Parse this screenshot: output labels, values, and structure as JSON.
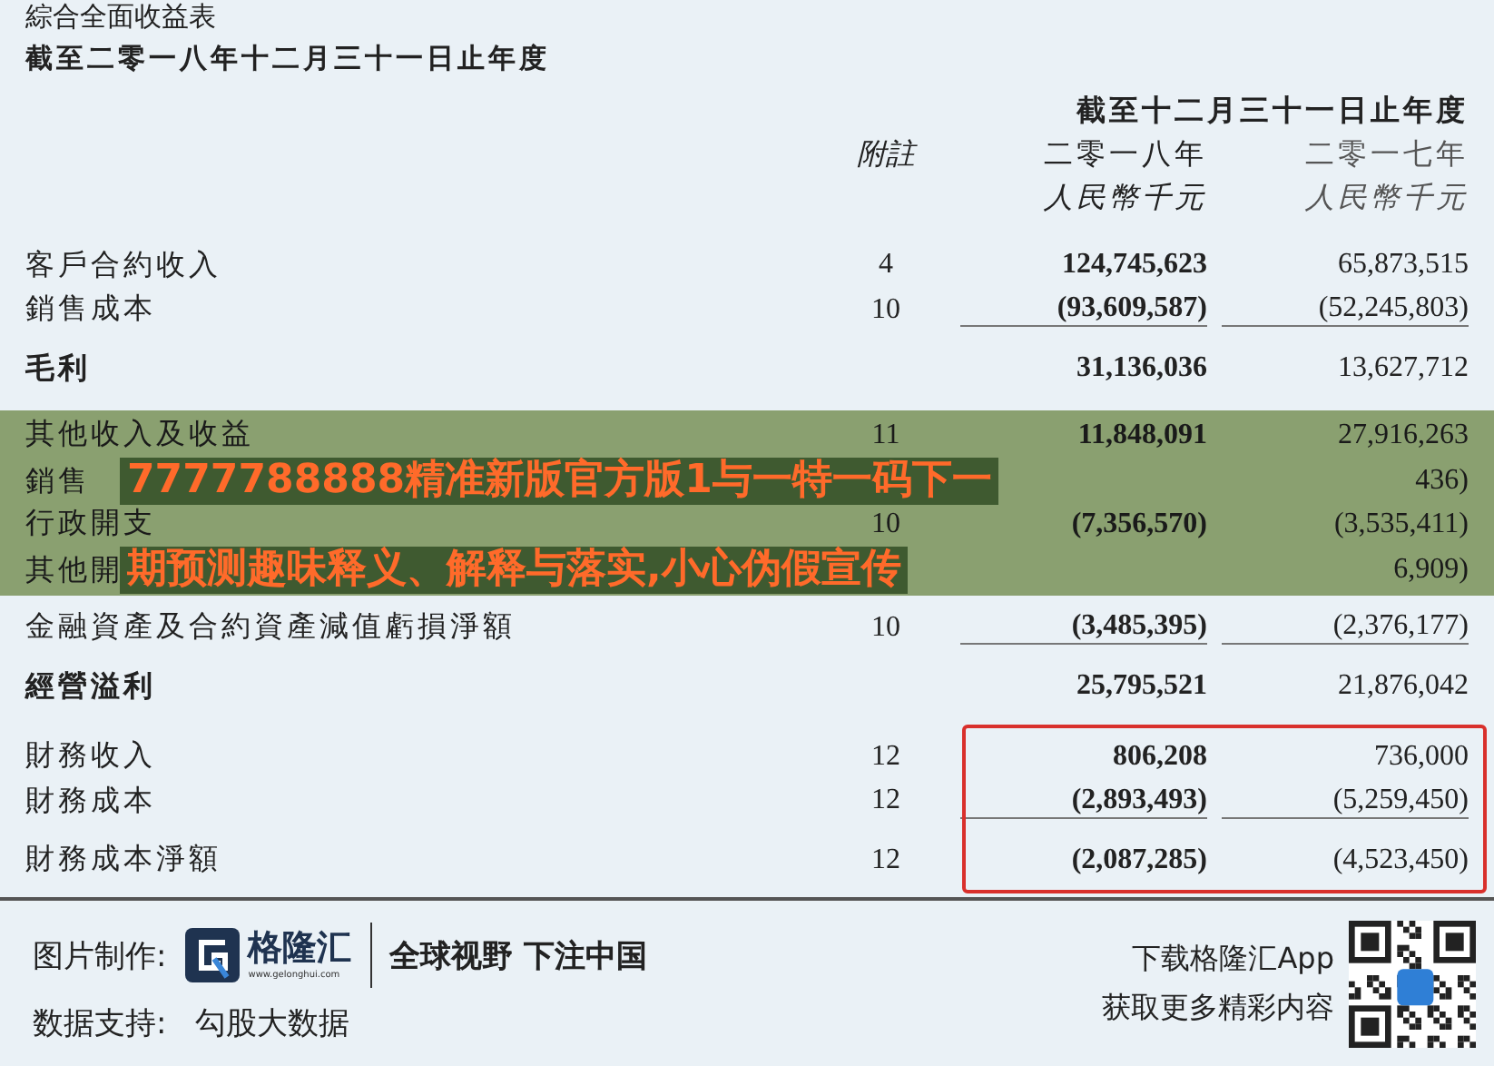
{
  "statement": {
    "title": "綜合全面收益表",
    "subtitle": "截至二零一八年十二月三十一日止年度",
    "period_header": "截至十二月三十一日止年度",
    "note_header": "附註",
    "years": [
      {
        "year": "二零一八年",
        "unit": "人民幣千元",
        "emphasis": true
      },
      {
        "year": "二零一七年",
        "unit": "人民幣千元",
        "emphasis": false
      }
    ],
    "rows": [
      {
        "kind": "item",
        "label": "客戶合約收入",
        "note": "4",
        "values": [
          "124,745,623",
          "65,873,515"
        ],
        "rule_below": false
      },
      {
        "kind": "item",
        "label": "銷售成本",
        "note": "10",
        "values": [
          "(93,609,587)",
          "(52,245,803)"
        ],
        "rule_below": true
      },
      {
        "kind": "total",
        "label": "毛利",
        "values": [
          "31,136,036",
          "13,627,712"
        ],
        "rule_below": false
      }
    ],
    "banner_band": [
      {
        "kind": "item",
        "label": "其他收入及收益",
        "note": "11",
        "values": [
          "11,848,091",
          "27,916,263"
        ],
        "rule_below": false
      },
      {
        "kind": "overlaid",
        "label": "銷售",
        "banner_text": "7777788888精准新版官方版1与一特一码下一",
        "value_2017": "436)"
      },
      {
        "kind": "item",
        "label": "行政開支",
        "note": "10",
        "values": [
          "(7,356,570)",
          "(3,535,411)"
        ],
        "rule_below": false
      },
      {
        "kind": "overlaid",
        "label": "其他開",
        "banner_text": "期预测趣味释义、解释与落实,小心伪假宣传",
        "value_2017": "6,909)"
      }
    ],
    "rows_after_banner": [
      {
        "kind": "item",
        "label": "金融資產及合約資產減值虧損淨額",
        "note": "10",
        "values": [
          "(3,485,395)",
          "(2,376,177)"
        ],
        "rule_below": true
      },
      {
        "kind": "total",
        "label": "經營溢利",
        "values": [
          "25,795,521",
          "21,876,042"
        ],
        "rule_below": false
      }
    ],
    "boxed_rows": [
      {
        "kind": "item",
        "label": "財務收入",
        "note": "12",
        "values": [
          "806,208",
          "736,000"
        ],
        "rule_below": false
      },
      {
        "kind": "item",
        "label": "財務成本",
        "note": "12",
        "values": [
          "(2,893,493)",
          "(5,259,450)"
        ],
        "rule_below": true
      },
      {
        "kind": "net",
        "label": "財務成本淨額",
        "note": "12",
        "values": [
          "(2,087,285)",
          "(4,523,450)"
        ],
        "rule_below": false
      }
    ]
  },
  "footer": {
    "made_by_label": "图片制作:",
    "logo_name": "格隆汇",
    "logo_url": "www.gelonghui.com",
    "slogan": "全球视野 下注中国",
    "data_label": "数据支持:",
    "data_source": "勾股大数据",
    "app_lines": [
      "下载格隆汇App",
      "获取更多精彩内容"
    ]
  }
}
